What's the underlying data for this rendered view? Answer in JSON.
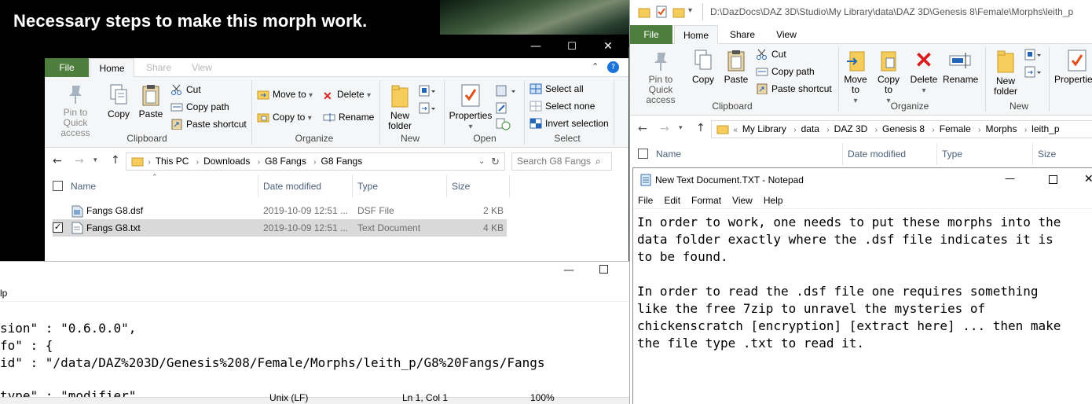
{
  "banner": {
    "title": "Necessary steps to make this morph work."
  },
  "left_explorer": {
    "controls": {
      "minimize": "—",
      "maximize": "☐",
      "close": "✕"
    },
    "tabs": [
      "File",
      "Home",
      "Share",
      "View"
    ],
    "clipboard": {
      "pin": "Pin to Quick access",
      "copy": "Copy",
      "paste": "Paste",
      "cut": "Cut",
      "copy_path": "Copy path",
      "paste_shortcut": "Paste shortcut",
      "group": "Clipboard"
    },
    "organize": {
      "move_to": "Move to",
      "copy_to": "Copy to",
      "delete": "Delete",
      "rename": "Rename",
      "group": "Organize"
    },
    "new": {
      "new_folder": "New folder",
      "group": "New"
    },
    "open": {
      "properties": "Properties",
      "group": "Open"
    },
    "select": {
      "select_all": "Select all",
      "select_none": "Select none",
      "invert": "Invert selection",
      "group": "Select"
    },
    "breadcrumb": [
      "This PC",
      "Downloads",
      "G8 Fangs",
      "G8 Fangs"
    ],
    "search_placeholder": "Search G8 Fangs",
    "columns": {
      "name": "Name",
      "date": "Date modified",
      "type": "Type",
      "size": "Size"
    },
    "files": [
      {
        "name": "Fangs G8.dsf",
        "date": "2019-10-09 12:51 ...",
        "type": "DSF File",
        "size": "2 KB"
      },
      {
        "name": "Fangs G8.txt",
        "date": "2019-10-09 12:51 ...",
        "type": "Text Document",
        "size": "4 KB"
      }
    ]
  },
  "left_notepad": {
    "menu_fragment": "lp",
    "lines": [
      "sion\" : \"0.6.0.0\",",
      "fo\" : {",
      "id\" : \"/data/DAZ%203D/Genesis%208/Female/Morphs/leith_p/G8%20Fangs/Fangs",
      "",
      "type\" : \"modifier\""
    ],
    "status": {
      "encoding": "Unix (LF)",
      "position": "Ln 1, Col 1",
      "zoom": "100%"
    }
  },
  "right_explorer": {
    "title_path": "D:\\DazDocs\\DAZ 3D\\Studio\\My Library\\data\\DAZ 3D\\Genesis 8\\Female\\Morphs\\leith_p",
    "tabs": [
      "File",
      "Home",
      "Share",
      "View"
    ],
    "clipboard": {
      "pin": "Pin to Quick access",
      "copy": "Copy",
      "paste": "Paste",
      "cut": "Cut",
      "copy_path": "Copy path",
      "paste_shortcut": "Paste shortcut",
      "group": "Clipboard"
    },
    "organize": {
      "move_to": "Move to",
      "copy_to": "Copy to",
      "delete": "Delete",
      "rename": "Rename",
      "group": "Organize"
    },
    "new": {
      "new_folder": "New folder",
      "group": "New"
    },
    "open": {
      "properties": "Properties"
    },
    "breadcrumb": [
      "My Library",
      "data",
      "DAZ 3D",
      "Genesis 8",
      "Female",
      "Morphs",
      "leith_p"
    ],
    "columns": {
      "name": "Name",
      "date": "Date modified",
      "type": "Type",
      "size": "Size"
    }
  },
  "notepad": {
    "title": "New Text Document.TXT - Notepad",
    "menu": [
      "File",
      "Edit",
      "Format",
      "View",
      "Help"
    ],
    "lines": [
      "In order to work, one needs to put these morphs into the",
      "data folder exactly where the .dsf file indicates it is",
      "to be found.",
      "",
      "In order to read the .dsf file one requires something",
      "like the free 7zip to unravel the mysteries of",
      "chickenscratch [encryption] [extract here] ... then make",
      "the file type .txt to read it."
    ]
  }
}
